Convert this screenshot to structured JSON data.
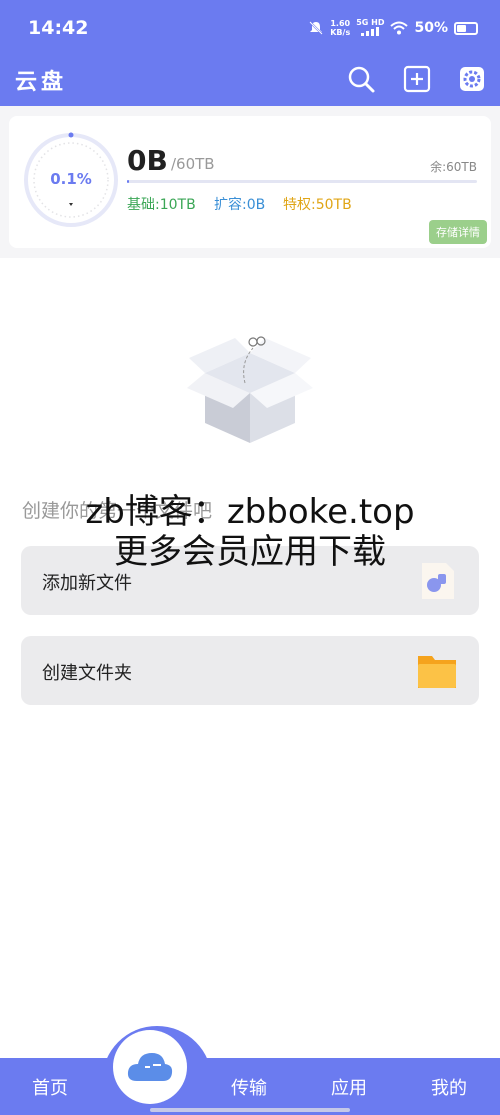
{
  "status_bar": {
    "time": "14:42",
    "net_speed_value": "1.60",
    "net_speed_unit": "KB/s",
    "network": "5G HD",
    "battery": "50%",
    "battery_level": 0.5
  },
  "app_bar": {
    "title": "云盘",
    "icons": [
      "search-icon",
      "add-icon",
      "settings-icon"
    ]
  },
  "storage": {
    "percent": "0.1%",
    "used": "0B",
    "total": "/60TB",
    "remaining": "余:60TB",
    "used_fraction": 0.001,
    "quota_base": "基础:10TB",
    "quota_expand": "扩容:0B",
    "quota_privilege": "特权:50TB",
    "detail_button": "存储详情",
    "colors": {
      "accent": "#6b7bf0",
      "base": "#3aa655",
      "expand": "#3a8fd6",
      "privilege": "#e0a516",
      "detail": "#9bcf8b"
    }
  },
  "empty_state": {
    "hint": "创建你的第一个文件吧"
  },
  "actions": [
    {
      "label": "添加新文件",
      "icon": "add-file-icon"
    },
    {
      "label": "创建文件夹",
      "icon": "folder-icon"
    }
  ],
  "watermark": {
    "line1": "zb博客：zbboke.top",
    "line2": "更多会员应用下载"
  },
  "bottom_nav": {
    "items": [
      {
        "label": "首页"
      },
      {
        "label": "传输"
      },
      {
        "label": "应用"
      },
      {
        "label": "我的"
      }
    ],
    "center_icon": "cloud-icon"
  }
}
